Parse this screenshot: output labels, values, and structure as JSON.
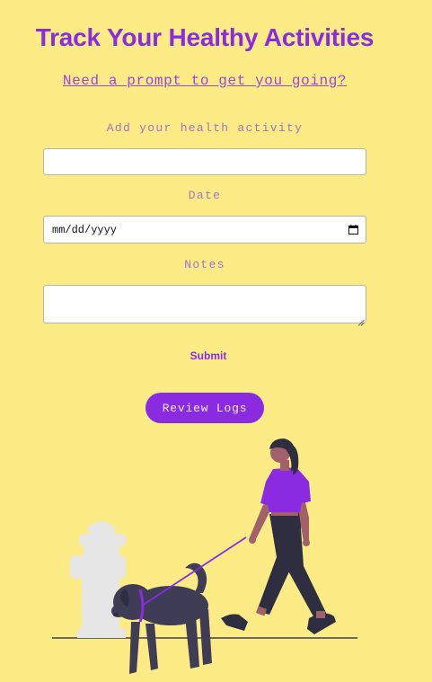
{
  "header": {
    "title": "Track Your Healthy Activities",
    "prompt_link": "Need a prompt to get you going?"
  },
  "form": {
    "activity_label": "Add your health activity",
    "activity_value": "",
    "date_label": "Date",
    "date_placeholder": "mm/dd/yyyy",
    "notes_label": "Notes",
    "notes_value": "",
    "submit_label": "Submit"
  },
  "actions": {
    "review_label": "Review Logs"
  },
  "illustration": {
    "subject": "woman-walking-dog-icon",
    "shirt_color": "#8a2be2",
    "dark_color": "#2f2e41",
    "hydrant_color": "#e6e6e6"
  },
  "colors": {
    "background": "#fdec86",
    "accent": "#8a2be2",
    "label": "#a474c4"
  }
}
